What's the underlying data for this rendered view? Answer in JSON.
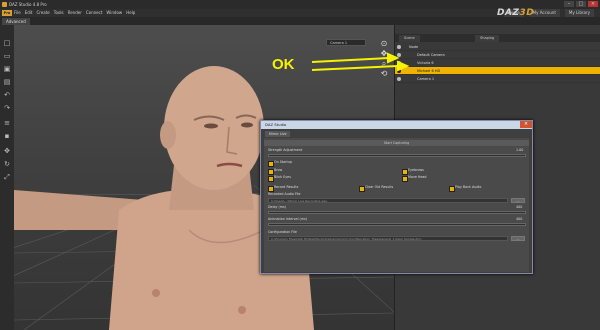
{
  "window": {
    "title": "DAZ Studio 4.8 Pro",
    "controls": {
      "minimize": "–",
      "maximize": "□",
      "close": "×"
    }
  },
  "menubar": {
    "badge": "Pro",
    "items": [
      "File",
      "Edit",
      "Create",
      "Tools",
      "Render",
      "Connect",
      "Window",
      "Help"
    ],
    "right_links": [
      "Home",
      "My Account",
      "My Library"
    ]
  },
  "logo": {
    "text": "DAZ",
    "accent": "3D"
  },
  "layout_tab": "Advanced",
  "viewport": {
    "camera": "Camera 1",
    "tools": [
      "new-icon",
      "open-icon",
      "save-icon",
      "undo-icon",
      "redo-icon",
      "render-icon",
      "move-icon",
      "rotate-icon",
      "scale-icon"
    ]
  },
  "scene": {
    "tabs": [
      "Scene",
      "Shaping"
    ],
    "items": [
      {
        "label": "Node",
        "selected": false
      },
      {
        "label": "Default Camera",
        "selected": false
      },
      {
        "label": "Victoria 6",
        "selected": false
      },
      {
        "label": "Michael 6 HD",
        "selected": true
      },
      {
        "label": "Camera 1",
        "selected": false
      }
    ]
  },
  "callout": {
    "text": "OK",
    "color": "#f4f400"
  },
  "dialog": {
    "title": "DAZ Studio",
    "close": "×",
    "tab": "Mimic Live",
    "start_bar": "Start Capturing",
    "strength_label": "Strength Adjustment",
    "strength_value": "1.00",
    "checkbox_header": "On Startup",
    "checkboxes_a": [
      "Brow",
      "Blink Eyes",
      "Eyebrows",
      "Move Head"
    ],
    "checkboxes_b": [
      "Record Results",
      "Clear Old Results",
      "Play Back Audio"
    ],
    "recorded_audio_label": "Recorded Audio File",
    "recorded_audio_value": "C:\\Users\\...\\Mimic Live Recording.wav",
    "delay_label": "Delay (ms)",
    "delay_value": "400",
    "interval_label": "Animation Interval (ms)",
    "interval_value": "400",
    "config_label": "Configuration File",
    "config_value": "C:\\Program Files\\DAZ 3D\\DAZStudio4\\plugins\\mimic\\Configuration_Files\\General_1 basic female.dmc",
    "button": "..."
  }
}
